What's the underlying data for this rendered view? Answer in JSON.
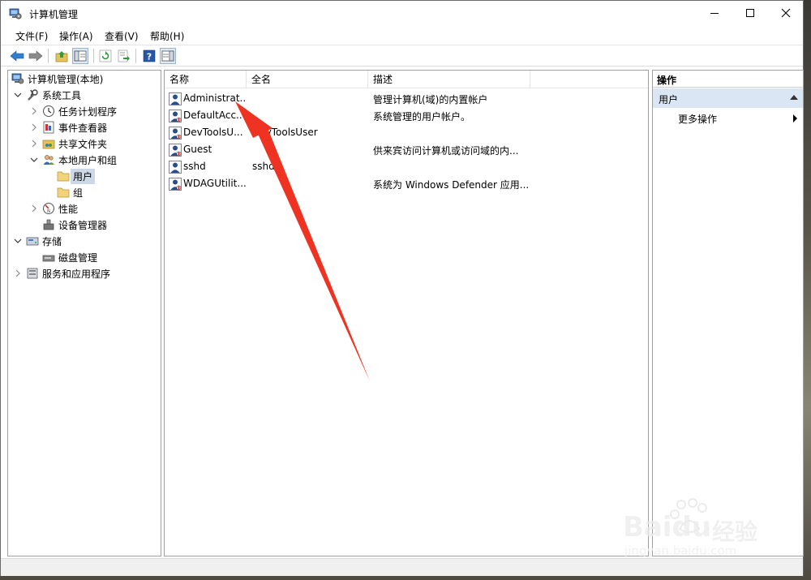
{
  "window": {
    "title": "计算机管理"
  },
  "menu": [
    {
      "label": "文件(F)"
    },
    {
      "label": "操作(A)"
    },
    {
      "label": "查看(V)"
    },
    {
      "label": "帮助(H)"
    }
  ],
  "tree": {
    "root": "计算机管理(本地)",
    "system_tools": "系统工具",
    "task_scheduler": "任务计划程序",
    "event_viewer": "事件查看器",
    "shared_folders": "共享文件夹",
    "local_users_groups": "本地用户和组",
    "users": "用户",
    "groups": "组",
    "performance": "性能",
    "device_manager": "设备管理器",
    "storage": "存储",
    "disk_management": "磁盘管理",
    "services_apps": "服务和应用程序"
  },
  "list": {
    "columns": {
      "name": "名称",
      "fullname": "全名",
      "description": "描述"
    },
    "rows": [
      {
        "name": "Administrat...",
        "fullname": "",
        "description": "管理计算机(域)的内置帐户"
      },
      {
        "name": "DefaultAcc...",
        "fullname": "",
        "description": "系统管理的用户帐户。"
      },
      {
        "name": "DevToolsU...",
        "fullname": "DevToolsUser",
        "description": ""
      },
      {
        "name": "Guest",
        "fullname": "",
        "description": "供来宾访问计算机或访问域的内..."
      },
      {
        "name": "sshd",
        "fullname": "sshd",
        "description": ""
      },
      {
        "name": "WDAGUtilit...",
        "fullname": "",
        "description": "系统为 Windows Defender 应用..."
      }
    ]
  },
  "actions": {
    "header": "操作",
    "section": "用户",
    "more": "更多操作"
  },
  "watermark": {
    "brand": "Baidu",
    "cn": "经验",
    "url": "jingyan.baidu.com"
  },
  "colors": {
    "annotation_arrow": "#ee3322",
    "selection": "#ccd8e6",
    "section_bg": "#dbe6f4"
  }
}
